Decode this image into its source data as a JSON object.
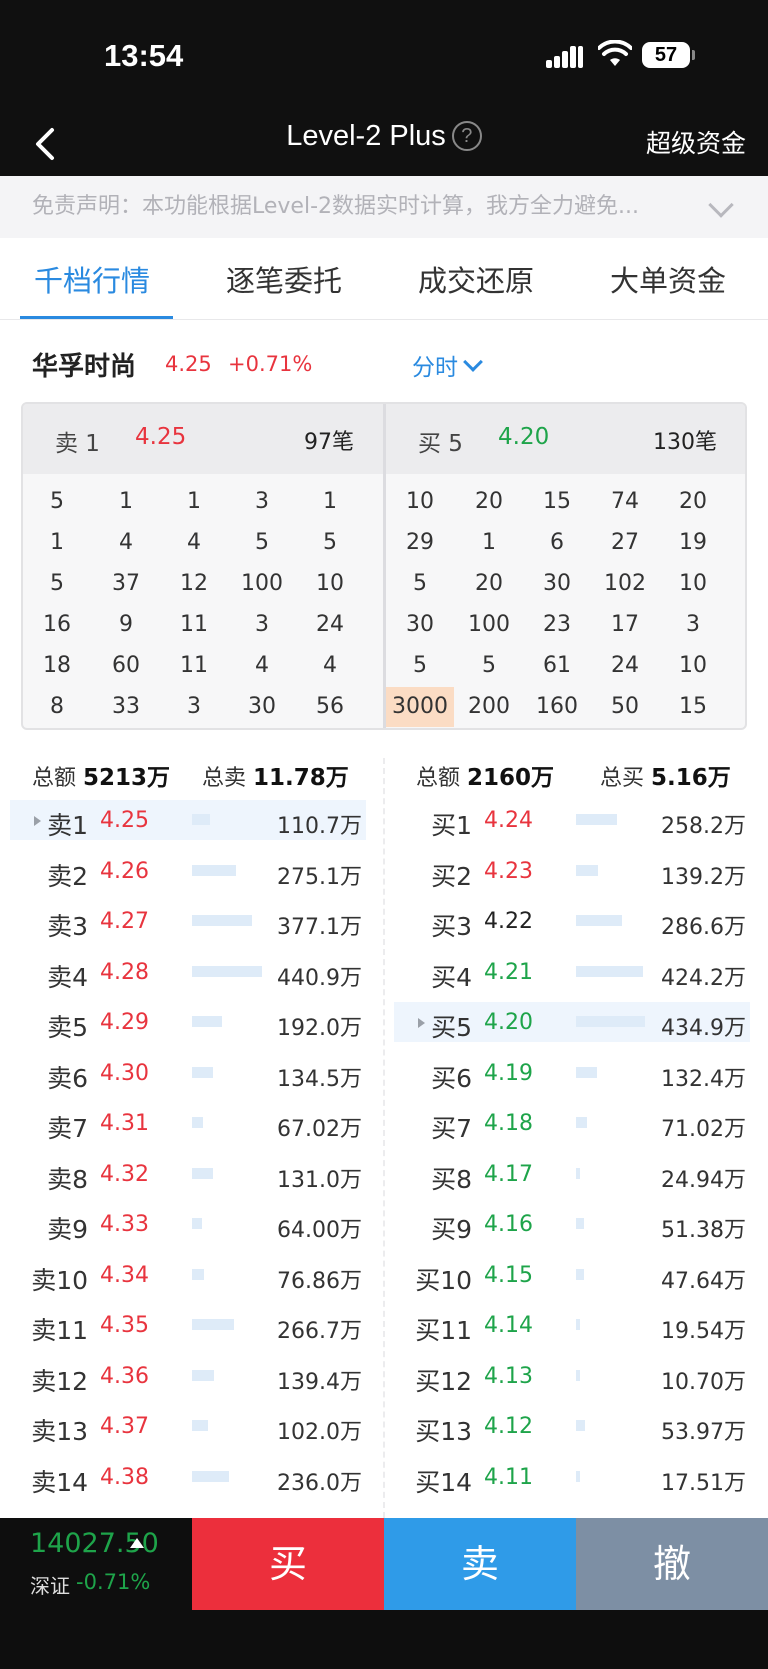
{
  "status": {
    "time": "13:54",
    "battery": "57"
  },
  "nav": {
    "title": "Level-2 Plus",
    "help": "?",
    "right": "超级资金"
  },
  "disclaimer": "免责声明：本功能根据Level-2数据实时计算，我方全力避免...",
  "tabs": [
    {
      "label": "千档行情",
      "active": true
    },
    {
      "label": "逐笔委托"
    },
    {
      "label": "成交还原"
    },
    {
      "label": "大单资金"
    }
  ],
  "stock": {
    "name": "华孚时尚",
    "price": "4.25",
    "change": "+0.71%",
    "period": "分时"
  },
  "queue": {
    "sell": {
      "label": "卖 1",
      "price": "4.25",
      "count": "97笔",
      "rows": [
        [
          "5",
          "1",
          "1",
          "3",
          "1"
        ],
        [
          "1",
          "4",
          "4",
          "5",
          "5"
        ],
        [
          "5",
          "37",
          "12",
          "100",
          "10"
        ],
        [
          "16",
          "9",
          "11",
          "3",
          "24"
        ],
        [
          "18",
          "60",
          "11",
          "4",
          "4"
        ],
        [
          "8",
          "33",
          "3",
          "30",
          "56"
        ]
      ]
    },
    "buy": {
      "label": "买 5",
      "price": "4.20",
      "count": "130笔",
      "rows": [
        [
          "10",
          "20",
          "15",
          "74",
          "20"
        ],
        [
          "29",
          "1",
          "6",
          "27",
          "19"
        ],
        [
          "5",
          "20",
          "30",
          "102",
          "10"
        ],
        [
          "30",
          "100",
          "23",
          "17",
          "3"
        ],
        [
          "5",
          "5",
          "61",
          "24",
          "10"
        ],
        [
          "3000",
          "200",
          "160",
          "50",
          "15"
        ]
      ]
    }
  },
  "book": {
    "sell_total_label": "总额",
    "sell_total": "5213万",
    "sell_qty_label": "总卖",
    "sell_qty": "11.78万",
    "buy_total_label": "总额",
    "buy_total": "2160万",
    "buy_qty_label": "总买",
    "buy_qty": "5.16万",
    "sell": [
      {
        "label": "卖1",
        "price": "4.25",
        "vol": "110.7万",
        "color": "red",
        "selected": true
      },
      {
        "label": "卖2",
        "price": "4.26",
        "vol": "275.1万",
        "color": "red"
      },
      {
        "label": "卖3",
        "price": "4.27",
        "vol": "377.1万",
        "color": "red"
      },
      {
        "label": "卖4",
        "price": "4.28",
        "vol": "440.9万",
        "color": "red"
      },
      {
        "label": "卖5",
        "price": "4.29",
        "vol": "192.0万",
        "color": "red"
      },
      {
        "label": "卖6",
        "price": "4.30",
        "vol": "134.5万",
        "color": "red"
      },
      {
        "label": "卖7",
        "price": "4.31",
        "vol": "67.02万",
        "color": "red"
      },
      {
        "label": "卖8",
        "price": "4.32",
        "vol": "131.0万",
        "color": "red"
      },
      {
        "label": "卖9",
        "price": "4.33",
        "vol": "64.00万",
        "color": "red"
      },
      {
        "label": "卖10",
        "price": "4.34",
        "vol": "76.86万",
        "color": "red"
      },
      {
        "label": "卖11",
        "price": "4.35",
        "vol": "266.7万",
        "color": "red"
      },
      {
        "label": "卖12",
        "price": "4.36",
        "vol": "139.4万",
        "color": "red"
      },
      {
        "label": "卖13",
        "price": "4.37",
        "vol": "102.0万",
        "color": "red"
      },
      {
        "label": "卖14",
        "price": "4.38",
        "vol": "236.0万",
        "color": "red"
      }
    ],
    "buy": [
      {
        "label": "买1",
        "price": "4.24",
        "vol": "258.2万",
        "color": "red"
      },
      {
        "label": "买2",
        "price": "4.23",
        "vol": "139.2万",
        "color": "red"
      },
      {
        "label": "买3",
        "price": "4.22",
        "vol": "286.6万",
        "color": "dark"
      },
      {
        "label": "买4",
        "price": "4.21",
        "vol": "424.2万",
        "color": "green"
      },
      {
        "label": "买5",
        "price": "4.20",
        "vol": "434.9万",
        "color": "green",
        "selected": true
      },
      {
        "label": "买6",
        "price": "4.19",
        "vol": "132.4万",
        "color": "green"
      },
      {
        "label": "买7",
        "price": "4.18",
        "vol": "71.02万",
        "color": "green"
      },
      {
        "label": "买8",
        "price": "4.17",
        "vol": "24.94万",
        "color": "green"
      },
      {
        "label": "买9",
        "price": "4.16",
        "vol": "51.38万",
        "color": "green"
      },
      {
        "label": "买10",
        "price": "4.15",
        "vol": "47.64万",
        "color": "green"
      },
      {
        "label": "买11",
        "price": "4.14",
        "vol": "19.54万",
        "color": "green"
      },
      {
        "label": "买12",
        "price": "4.13",
        "vol": "10.70万",
        "color": "green"
      },
      {
        "label": "买13",
        "price": "4.12",
        "vol": "53.97万",
        "color": "green"
      },
      {
        "label": "买14",
        "price": "4.11",
        "vol": "17.51万",
        "color": "green"
      }
    ]
  },
  "bottom": {
    "index_value": "14027.50",
    "index_name": "深证",
    "index_change": "-0.71%",
    "buy": "买",
    "sell": "卖",
    "cancel": "撤"
  }
}
